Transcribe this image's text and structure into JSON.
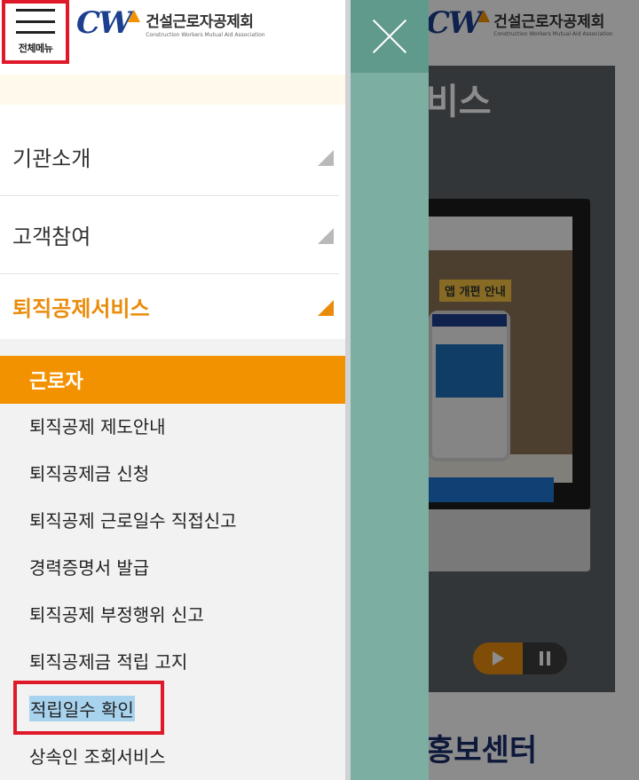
{
  "header": {
    "menu_label": "전체메뉴",
    "logo_mark": "CW",
    "org_name_ko": "건설근로자공제회",
    "org_name_en": "Construction Workers Mutual Aid Association"
  },
  "top_menu": [
    {
      "label": "기관소개",
      "active": false
    },
    {
      "label": "고객참여",
      "active": false
    },
    {
      "label": "퇴직공제서비스",
      "active": true
    }
  ],
  "sub_menu": {
    "section": "근로자",
    "items": [
      "퇴직공제 제도안내",
      "퇴직공제금 신청",
      "퇴직공제 근로일수 직접신고",
      "경력증명서 발급",
      "퇴직공제 부정행위 신고",
      "퇴직공제금 적립 고지",
      "적립일수 확인",
      "상속인 조회서비스"
    ],
    "highlighted_item": "적립일수 확인"
  },
  "background_page": {
    "hero_title_fragment": "비스",
    "app_badge": "앱 개편 안내",
    "section_title_fragment": "홍보센터"
  },
  "colors": {
    "accent": "#f39200",
    "brand": "#1c3f8f",
    "close_strip": "#7daea2",
    "highlight": "#a8d3ee",
    "annotation": "#e0192a"
  },
  "icons": {
    "menu": "hamburger-icon",
    "close": "close-icon",
    "expand": "triangle-arrow-icon",
    "play": "play-icon",
    "pause": "pause-icon"
  }
}
